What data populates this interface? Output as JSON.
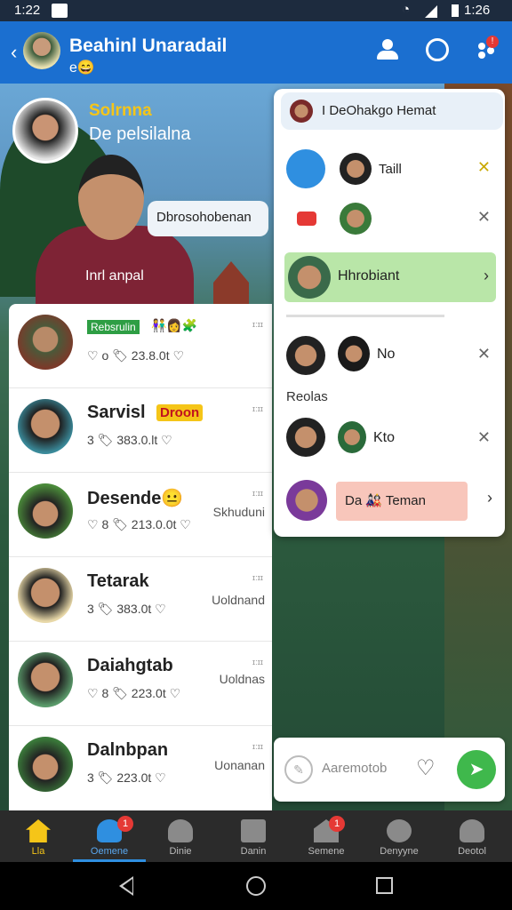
{
  "status_bar": {
    "time": "1:22",
    "right_time": "1:26"
  },
  "app_bar": {
    "title": "Beahinl Unaradail",
    "subtitle_emoji": "e😄"
  },
  "profile": {
    "name": "Solrnna",
    "status": "De pelsilalna"
  },
  "chat_bubble": "Dbrosohobenan",
  "person_label": "Inrl anpal",
  "feed": [
    {
      "name": "Rebsrulin",
      "meta": "♡ o 🏷 23.8.0t ♡",
      "side": "",
      "badge": "Rebsrulin"
    },
    {
      "name": "Sarvisl",
      "tag": "Droon",
      "meta": "3 🏷 383.0.lt ♡",
      "side": ""
    },
    {
      "name": "Desende😐",
      "meta": "♡ 8 🏷 213.0.0t ♡",
      "side": "Skhuduni"
    },
    {
      "name": "Tetarak",
      "meta": "3 🏷 383.0t ♡",
      "side": "Uoldnand"
    },
    {
      "name": "Daiahgtab",
      "meta": "♡ 8 🏷 223.0t ♡",
      "side": "Uoldnas"
    },
    {
      "name": "Dalnbpan",
      "meta": "3 🏷 223.0t ♡",
      "side": "Uonanan"
    }
  ],
  "panel": {
    "search": "I DeOhakgo Hemat",
    "row1_label": "Taill",
    "highlight": "Hhrobiant",
    "row4_label": "No",
    "section": "Reolas",
    "row5_label": "Kto",
    "action": "Da 🎎 Teman",
    "compose_placeholder": "Aaremotob"
  },
  "nav": [
    {
      "label": "Lla",
      "active": true
    },
    {
      "label": "Oemene",
      "active": false,
      "badge": "1"
    },
    {
      "label": "Dinie",
      "active": false
    },
    {
      "label": "Danin",
      "active": false
    },
    {
      "label": "Semene",
      "active": false,
      "badge": "1"
    },
    {
      "label": "Denyyne",
      "active": false
    },
    {
      "label": "Deotol",
      "active": false
    }
  ],
  "colors": {
    "appbar": "#1b6fd0",
    "accent": "#2f8fe0",
    "highlight": "#b9e6a8",
    "action": "#f8c6bb",
    "send": "#3fb84c"
  }
}
